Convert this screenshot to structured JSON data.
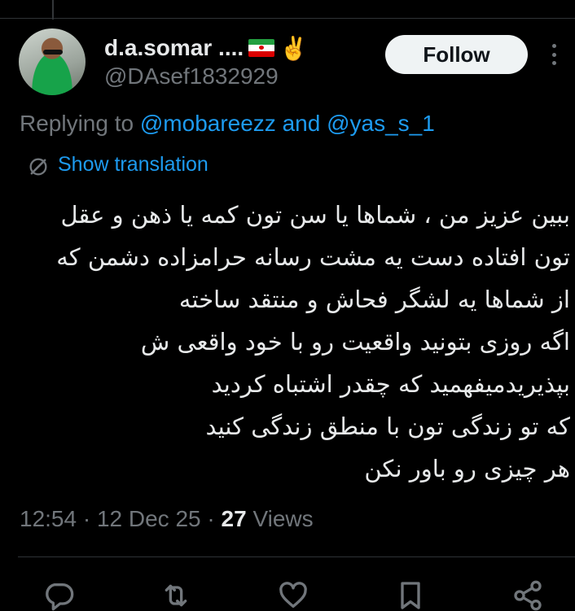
{
  "author": {
    "display_name": "d.a.somar ....",
    "flag_emoji": "iran-flag",
    "victory_emoji": "✌️",
    "handle": "@DAsef1832929",
    "avatar": "avatar-photo"
  },
  "header": {
    "follow_label": "Follow",
    "more_icon": "more-vertical-icon"
  },
  "reply_context": {
    "prefix": "Replying to",
    "mention_1": "@mobareezz",
    "conjunction": "and",
    "mention_2": "@yas_s_1"
  },
  "translation": {
    "icon": "translate-icon",
    "label": "Show translation"
  },
  "tweet": {
    "lines": [
      "ببین عزیز من ، شماها یا سن تون کمه یا ذهن و عقل",
      "تون  افتاده دست یه مشت رسانه حرامزاده  دشمن  که",
      "از شماها یه لشگر فحاش و منتقد ساخته",
      "اگه روزی بتونید واقعیت رو با خود واقعی ش",
      "بپذیریدمیفهمید که چقدر اشتباه کردید",
      "که تو زندگی تون با منطق زندگی کنید",
      "هر چیزی رو باور نکن"
    ]
  },
  "meta": {
    "time": "12:54",
    "separator": "·",
    "date": "12 Dec 25",
    "views_count": "27",
    "views_label": "Views"
  },
  "actions": {
    "reply_icon": "reply-icon",
    "retweet_icon": "retweet-icon",
    "like_icon": "heart-icon",
    "bookmark_icon": "bookmark-icon",
    "share_icon": "share-icon"
  },
  "colors": {
    "background": "#000000",
    "text_primary": "#e7e9ea",
    "text_secondary": "#71767b",
    "accent": "#1d9bf0",
    "divider": "#2f3336",
    "follow_bg": "#eff3f4"
  }
}
